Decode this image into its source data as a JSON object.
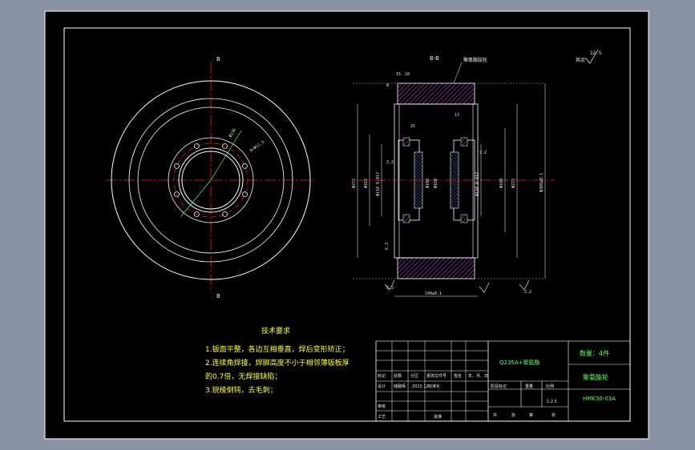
{
  "colors": {
    "background": "#8a93a5",
    "paper": "#000000",
    "frame": "#ffffff",
    "centerline": "#ff2020",
    "dimension": "#ffffff",
    "hatch": "#d24aff",
    "text_requirements": "#ffff3c",
    "titleblock_text": "#66ff66"
  },
  "views": {
    "front_view": {
      "section_mark_top": "B",
      "section_mark_bottom": "B",
      "pcd_label": "Φ136",
      "hole_label": "8×Φ11.5"
    },
    "section_view": {
      "title": "B-B",
      "leader_note": "聚氨酯胶轮",
      "dims_top": [
        "15",
        "10",
        "8"
      ],
      "dims_side_left": [
        "Φ272",
        "Φ162",
        "Φ110 0.017"
      ],
      "dims_inner_left": [
        "Φ100",
        "Φ160"
      ],
      "dims_side_right": [
        "Φ110 0.017",
        "Φ180",
        "Φ272",
        "Φ300±0.1"
      ],
      "inner_top_labels": [
        "25",
        "13"
      ],
      "bottom_width": "140±0.1",
      "roughness_labels": [
        "3.2",
        "3.2",
        "3.2",
        "3.2",
        "6.3"
      ]
    },
    "roughness_general": {
      "value": "12.5",
      "note": "其余"
    }
  },
  "requirements": {
    "title": "技术要求",
    "lines": [
      "1.钣面平整，各边互相垂直，焊后变形矫正；",
      "2.连续角焊接，焊脚高度不小于相邻薄钣板厚",
      "的0.7倍，无焊接缺陷；",
      "3.锐棱倒钝，去毛刺；"
    ]
  },
  "title_block": {
    "material": "Q235A+聚氨酯",
    "quantity": "数量：4件",
    "part_name": "聚氨酯轮",
    "drawing_no": "HMK30-03A",
    "scale": "1:2.5",
    "date": "2015.12",
    "header_row": [
      "标记",
      "处数",
      "分区",
      "更改文件号",
      "签名",
      "年、月、日"
    ],
    "row_labels": [
      "设计",
      "审核",
      "工艺"
    ],
    "designer": "储融晖",
    "standardization": "标准化",
    "approve": "批准",
    "stage_labels": [
      "阶段标记",
      "重量",
      "比例"
    ],
    "sheet_labels": [
      "共",
      "张",
      "第",
      "张"
    ]
  }
}
